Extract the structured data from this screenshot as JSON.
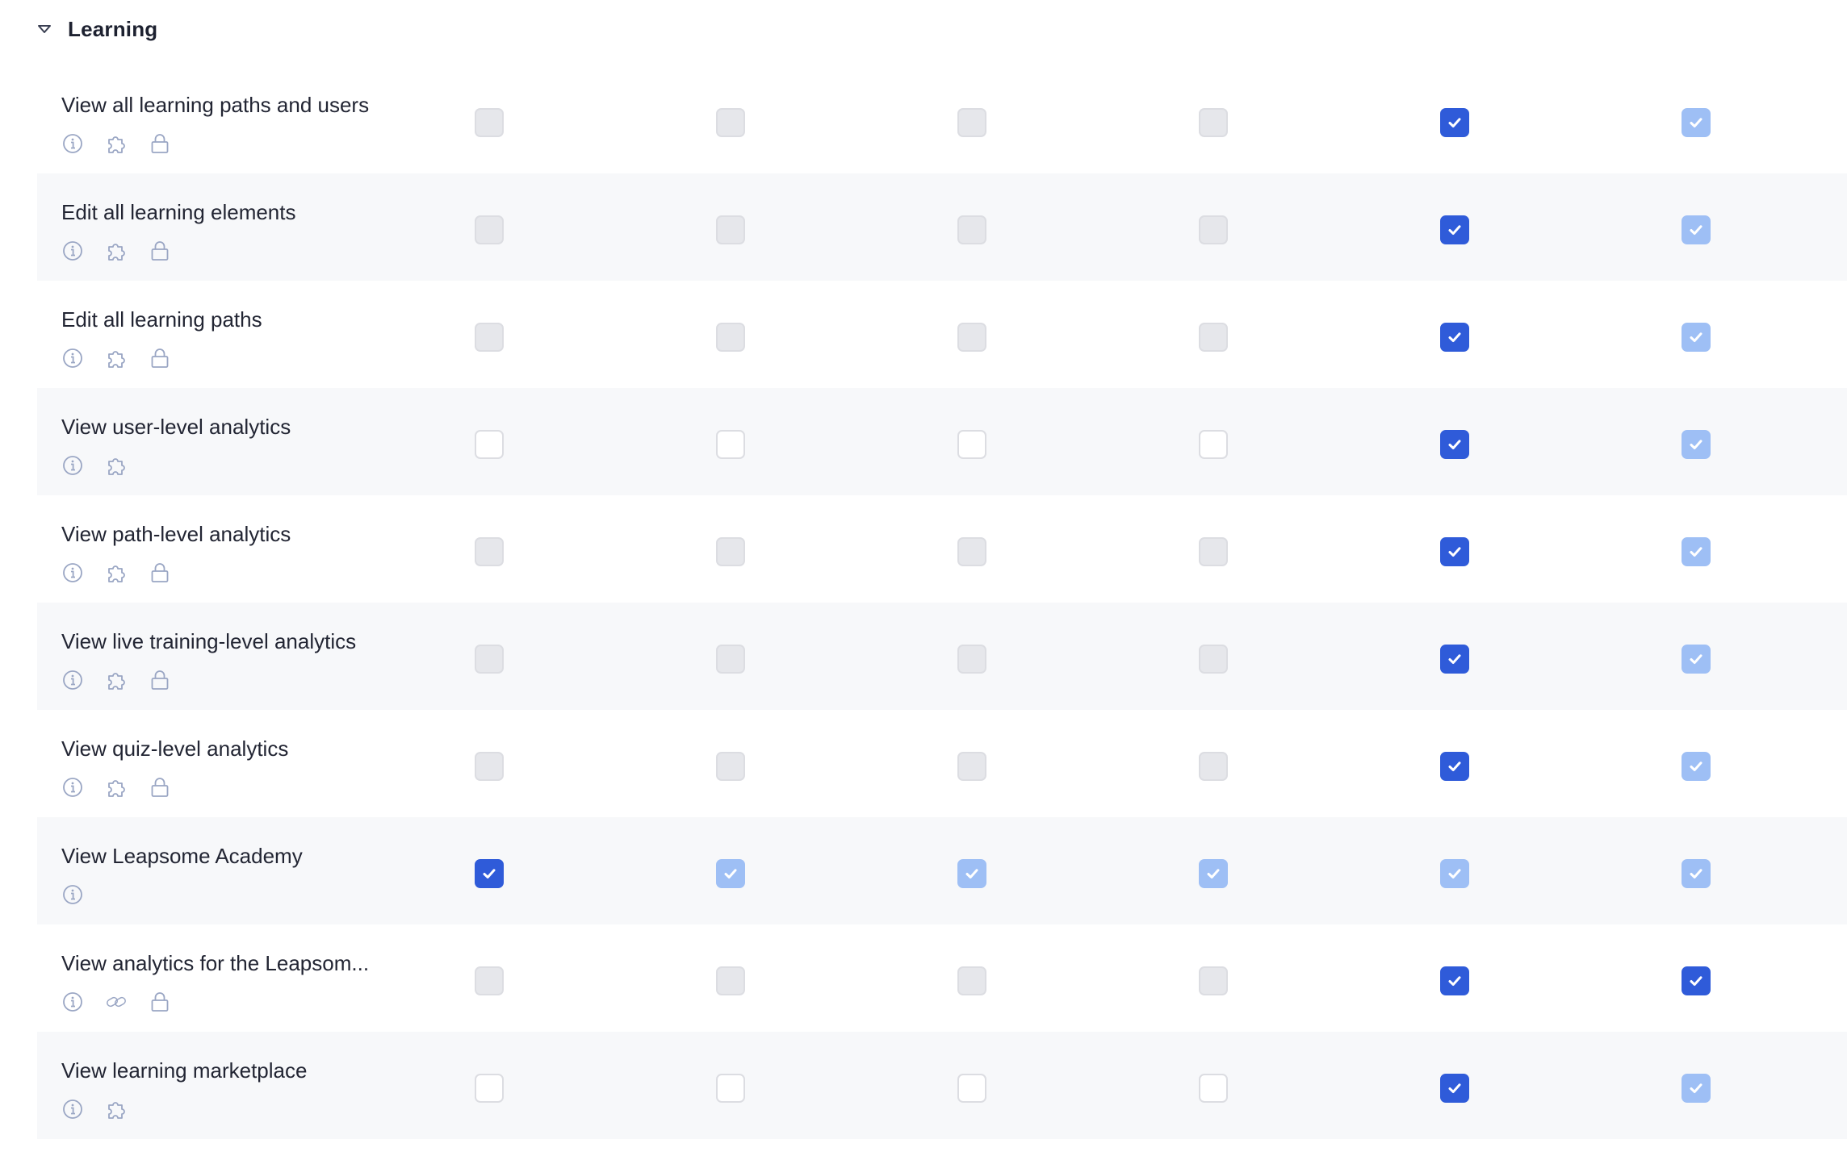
{
  "section": {
    "title": "Learning",
    "expanded": true
  },
  "colors": {
    "checked": "#2f5bd9",
    "checked_inherited": "#9ebff5",
    "disabled": "#e6e7eb",
    "empty": "#ffffff",
    "row_alt": "#f7f8fa",
    "icon": "#9aa6c4"
  },
  "permissions": [
    {
      "label": "View all learning paths and users",
      "icons": [
        "info-icon",
        "puzzle-icon",
        "lock-icon"
      ],
      "states": [
        "disabled",
        "disabled",
        "disabled",
        "disabled",
        "checked",
        "checked-light"
      ]
    },
    {
      "label": "Edit all learning elements",
      "icons": [
        "info-icon",
        "puzzle-icon",
        "lock-icon"
      ],
      "states": [
        "disabled",
        "disabled",
        "disabled",
        "disabled",
        "checked",
        "checked-light"
      ]
    },
    {
      "label": "Edit all learning paths",
      "icons": [
        "info-icon",
        "puzzle-icon",
        "lock-icon"
      ],
      "states": [
        "disabled",
        "disabled",
        "disabled",
        "disabled",
        "checked",
        "checked-light"
      ]
    },
    {
      "label": "View user-level analytics",
      "icons": [
        "info-icon",
        "puzzle-icon"
      ],
      "states": [
        "empty",
        "empty",
        "empty",
        "empty",
        "checked",
        "checked-light"
      ]
    },
    {
      "label": "View path-level analytics",
      "icons": [
        "info-icon",
        "puzzle-icon",
        "lock-icon"
      ],
      "states": [
        "disabled",
        "disabled",
        "disabled",
        "disabled",
        "checked",
        "checked-light"
      ]
    },
    {
      "label": "View live training-level analytics",
      "icons": [
        "info-icon",
        "puzzle-icon",
        "lock-icon"
      ],
      "states": [
        "disabled",
        "disabled",
        "disabled",
        "disabled",
        "checked",
        "checked-light"
      ]
    },
    {
      "label": "View quiz-level analytics",
      "icons": [
        "info-icon",
        "puzzle-icon",
        "lock-icon"
      ],
      "states": [
        "disabled",
        "disabled",
        "disabled",
        "disabled",
        "checked",
        "checked-light"
      ]
    },
    {
      "label": "View Leapsome Academy",
      "icons": [
        "info-icon"
      ],
      "states": [
        "checked",
        "checked-light",
        "checked-light",
        "checked-light",
        "checked-light",
        "checked-light"
      ]
    },
    {
      "label": "View analytics for the Leapsom...",
      "icons": [
        "info-icon",
        "link-icon",
        "lock-icon"
      ],
      "states": [
        "disabled",
        "disabled",
        "disabled",
        "disabled",
        "checked",
        "checked"
      ]
    },
    {
      "label": "View learning marketplace",
      "icons": [
        "info-icon",
        "puzzle-icon"
      ],
      "states": [
        "empty",
        "empty",
        "empty",
        "empty",
        "checked",
        "checked-light"
      ]
    }
  ]
}
